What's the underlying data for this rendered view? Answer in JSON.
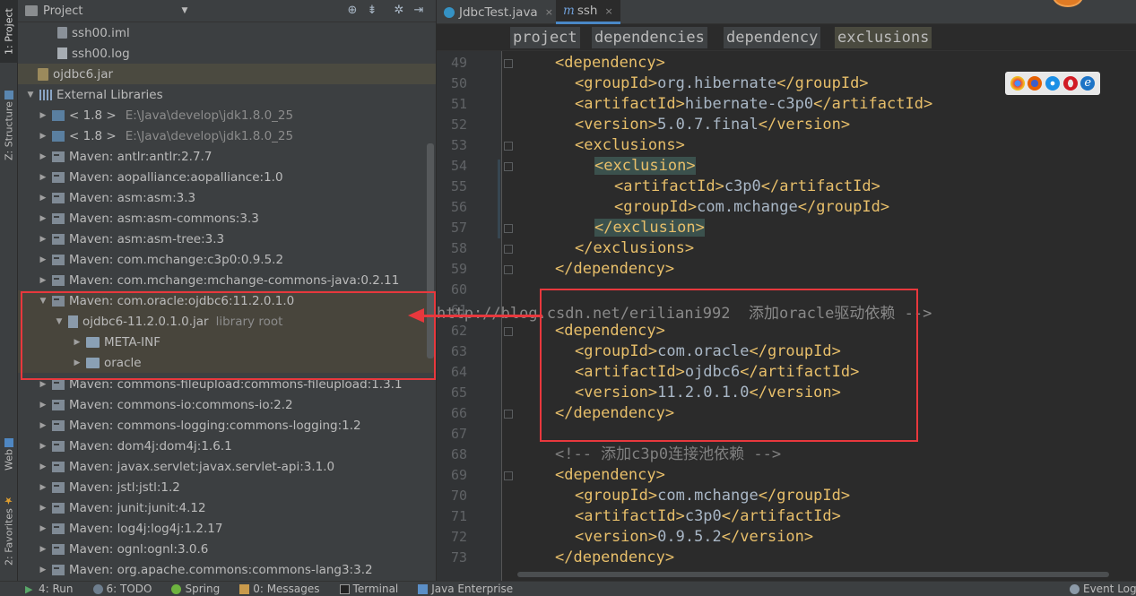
{
  "left_tool_tabs": [
    {
      "label": "1: Project"
    },
    {
      "label": "Z: Structure"
    },
    {
      "label": "Web"
    },
    {
      "label": "2: Favorites"
    }
  ],
  "project_panel": {
    "title": "Project",
    "tree": [
      {
        "label": "ssh00.iml",
        "path": "",
        "sub": ""
      },
      {
        "label": "ssh00.log",
        "path": "",
        "sub": ""
      },
      {
        "label": "ojdbc6.jar",
        "path": "",
        "sub": ""
      },
      {
        "label": "External Libraries",
        "path": "",
        "sub": ""
      },
      {
        "label": "< 1.8 >",
        "path": "E:\\Java\\develop\\jdk1.8.0_25",
        "sub": ""
      },
      {
        "label": "< 1.8 >",
        "path": "E:\\Java\\develop\\jdk1.8.0_25",
        "sub": ""
      },
      {
        "label": "Maven: antlr:antlr:2.7.7",
        "path": "",
        "sub": ""
      },
      {
        "label": "Maven: aopalliance:aopalliance:1.0",
        "path": "",
        "sub": ""
      },
      {
        "label": "Maven: asm:asm:3.3",
        "path": "",
        "sub": ""
      },
      {
        "label": "Maven: asm:asm-commons:3.3",
        "path": "",
        "sub": ""
      },
      {
        "label": "Maven: asm:asm-tree:3.3",
        "path": "",
        "sub": ""
      },
      {
        "label": "Maven: com.mchange:c3p0:0.9.5.2",
        "path": "",
        "sub": ""
      },
      {
        "label": "Maven: com.mchange:mchange-commons-java:0.2.11",
        "path": "",
        "sub": ""
      },
      {
        "label": "Maven: com.oracle:ojdbc6:11.2.0.1.0",
        "path": "",
        "sub": ""
      },
      {
        "label": "ojdbc6-11.2.0.1.0.jar",
        "path": "",
        "sub": "library root"
      },
      {
        "label": "META-INF",
        "path": "",
        "sub": ""
      },
      {
        "label": "oracle",
        "path": "",
        "sub": ""
      },
      {
        "label": "Maven: commons-fileupload:commons-fileupload:1.3.1",
        "path": "",
        "sub": ""
      },
      {
        "label": "Maven: commons-io:commons-io:2.2",
        "path": "",
        "sub": ""
      },
      {
        "label": "Maven: commons-logging:commons-logging:1.2",
        "path": "",
        "sub": ""
      },
      {
        "label": "Maven: dom4j:dom4j:1.6.1",
        "path": "",
        "sub": ""
      },
      {
        "label": "Maven: javax.servlet:javax.servlet-api:3.1.0",
        "path": "",
        "sub": ""
      },
      {
        "label": "Maven: jstl:jstl:1.2",
        "path": "",
        "sub": ""
      },
      {
        "label": "Maven: junit:junit:4.12",
        "path": "",
        "sub": ""
      },
      {
        "label": "Maven: log4j:log4j:1.2.17",
        "path": "",
        "sub": ""
      },
      {
        "label": "Maven: ognl:ognl:3.0.6",
        "path": "",
        "sub": ""
      },
      {
        "label": "Maven: org.apache.commons:commons-lang3:3.2",
        "path": "",
        "sub": ""
      }
    ]
  },
  "editor": {
    "tabs": [
      {
        "label": "JdbcTest.java"
      },
      {
        "label": "ssh"
      }
    ],
    "breadcrumb": [
      "project",
      "dependencies",
      "dependency",
      "exclusions"
    ],
    "line_numbers": [
      "49",
      "50",
      "51",
      "52",
      "53",
      "54",
      "55",
      "56",
      "57",
      "58",
      "59",
      "60",
      "61",
      "62",
      "63",
      "64",
      "65",
      "66",
      "67",
      "68",
      "69",
      "70",
      "71",
      "72",
      "73"
    ],
    "code": [
      {
        "open": "<dependency>",
        "text": "",
        "close": ""
      },
      {
        "open": "<groupId>",
        "text": "org.hibernate",
        "close": "</groupId>"
      },
      {
        "open": "<artifactId>",
        "text": "hibernate-c3p0",
        "close": "</artifactId>"
      },
      {
        "open": "<version>",
        "text": "5.0.7.final",
        "close": "</version>"
      },
      {
        "open": "<exclusions>",
        "text": "",
        "close": ""
      },
      {
        "open": "<exclusion>",
        "text": "",
        "close": ""
      },
      {
        "open": "<artifactId>",
        "text": "c3p0",
        "close": "</artifactId>"
      },
      {
        "open": "<groupId>",
        "text": "com.mchange",
        "close": "</groupId>"
      },
      {
        "open": "</exclusion>",
        "text": "",
        "close": ""
      },
      {
        "open": "</exclusions>",
        "text": "",
        "close": ""
      },
      {
        "open": "</dependency>",
        "text": "",
        "close": ""
      },
      {
        "open": "",
        "text": "",
        "close": ""
      },
      {
        "open": "",
        "text": "",
        "close": ""
      },
      {
        "open": "<dependency>",
        "text": "",
        "close": ""
      },
      {
        "open": "<groupId>",
        "text": "com.oracle",
        "close": "</groupId>"
      },
      {
        "open": "<artifactId>",
        "text": "ojdbc6",
        "close": "</artifactId>"
      },
      {
        "open": "<version>",
        "text": "11.2.0.1.0",
        "close": "</version>"
      },
      {
        "open": "</dependency>",
        "text": "",
        "close": ""
      },
      {
        "open": "",
        "text": "",
        "close": ""
      },
      {
        "open": "",
        "text": "<!-- 添加c3p0连接池依赖 -->",
        "close": ""
      },
      {
        "open": "<dependency>",
        "text": "",
        "close": ""
      },
      {
        "open": "<groupId>",
        "text": "com.mchange",
        "close": "</groupId>"
      },
      {
        "open": "<artifactId>",
        "text": "c3p0",
        "close": "</artifactId>"
      },
      {
        "open": "<version>",
        "text": "0.9.5.2",
        "close": "</version>"
      },
      {
        "open": "</dependency>",
        "text": "",
        "close": ""
      }
    ],
    "overlay_line_61": "http://blog.csdn.net/eriliani992  添加oracle驱动依赖 -->"
  },
  "status_bar": [
    {
      "label": "4: Run"
    },
    {
      "label": "6: TODO"
    },
    {
      "label": "Spring"
    },
    {
      "label": "0: Messages"
    },
    {
      "label": "Terminal"
    },
    {
      "label": "Java Enterprise"
    },
    {
      "label": "Event Log"
    }
  ],
  "colors": {
    "annotation": "#e8383d",
    "tag": "#e8bf6a",
    "text": "#a9b7c6",
    "comment": "#808080"
  }
}
